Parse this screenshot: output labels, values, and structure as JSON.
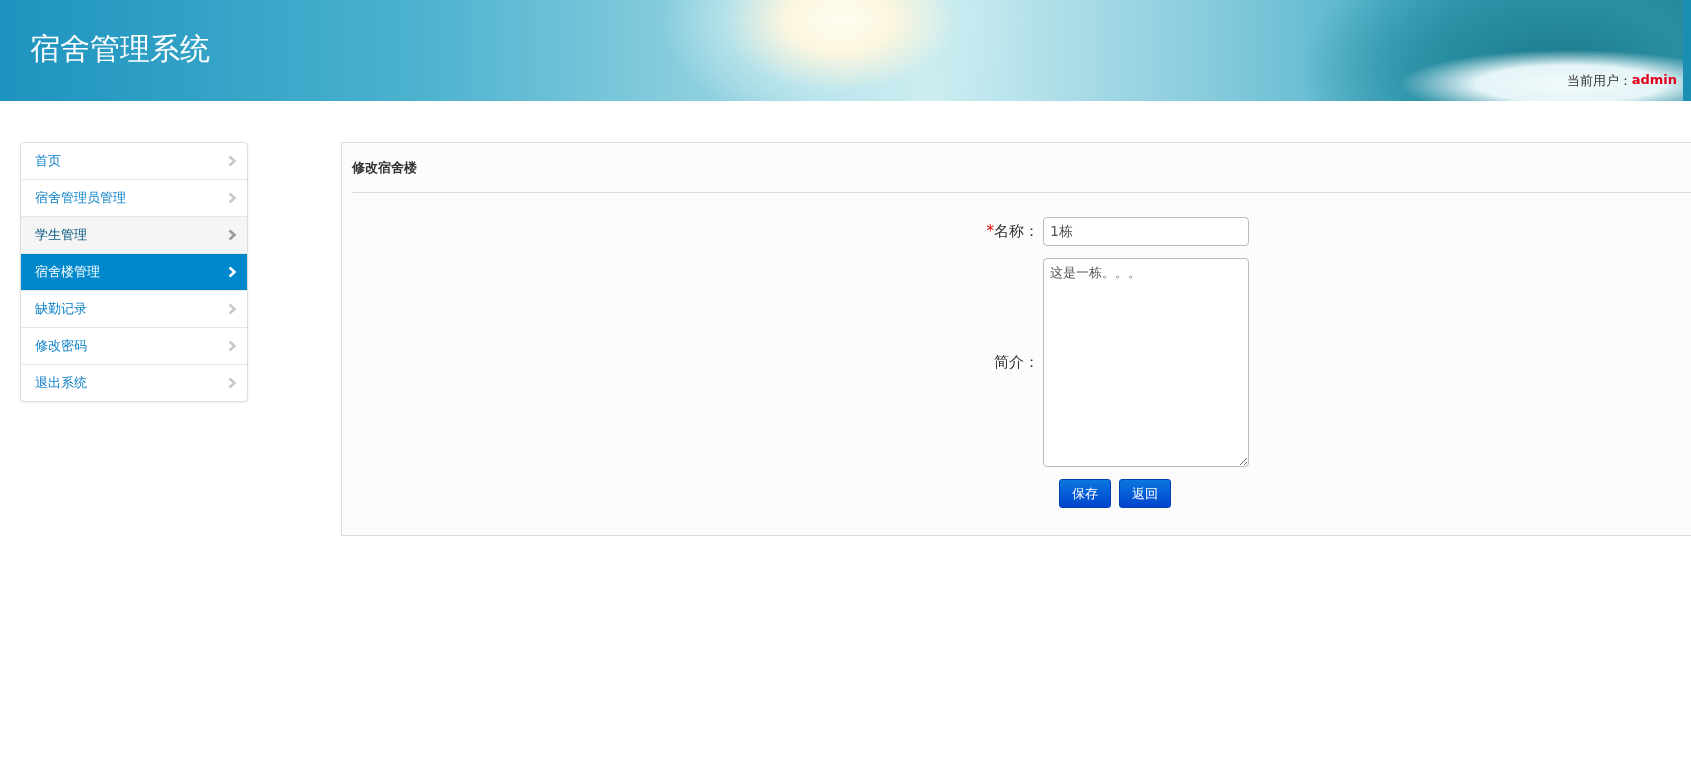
{
  "header": {
    "title": "宿舍管理系统",
    "user_label": "当前用户：",
    "user_name": "admin"
  },
  "sidebar": {
    "items": [
      {
        "label": "首页",
        "selected": false,
        "hovered": false
      },
      {
        "label": "宿舍管理员管理",
        "selected": false,
        "hovered": false
      },
      {
        "label": "学生管理",
        "selected": false,
        "hovered": true
      },
      {
        "label": "宿舍楼管理",
        "selected": true,
        "hovered": false
      },
      {
        "label": "缺勤记录",
        "selected": false,
        "hovered": false
      },
      {
        "label": "修改密码",
        "selected": false,
        "hovered": false
      },
      {
        "label": "退出系统",
        "selected": false,
        "hovered": false
      }
    ]
  },
  "panel": {
    "title": "修改宿舍楼",
    "fields": [
      {
        "kind": "input",
        "required_mark": "*",
        "label": "名称：",
        "value": "1栋"
      },
      {
        "kind": "textarea",
        "label": "简介：",
        "value": "这是一栋。。。"
      }
    ],
    "buttons": [
      "保存",
      "返回"
    ]
  }
}
